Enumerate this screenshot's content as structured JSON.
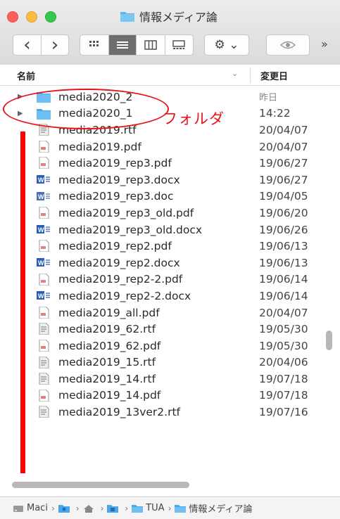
{
  "window": {
    "title": "情報メディア論"
  },
  "toolbar": {
    "back_label": "‹",
    "forward_label": "›",
    "gear_label": "⚙ ⌄",
    "eye_label": "◉",
    "overflow_label": "»"
  },
  "columns": {
    "name": "名前",
    "date": "変更日"
  },
  "files": [
    {
      "name": "media2020_2",
      "date": "昨日",
      "kind": "folder"
    },
    {
      "name": "media2020_1",
      "date": "14:22",
      "kind": "folder"
    },
    {
      "name": "media2019.rtf",
      "date": "20/04/07",
      "kind": "rtf"
    },
    {
      "name": "media2019.pdf",
      "date": "20/04/07",
      "kind": "pdf"
    },
    {
      "name": "media2019_rep3.pdf",
      "date": "19/06/27",
      "kind": "pdf"
    },
    {
      "name": "media2019_rep3.docx",
      "date": "19/06/27",
      "kind": "docx"
    },
    {
      "name": "media2019_rep3.doc",
      "date": "19/04/05",
      "kind": "doc"
    },
    {
      "name": "media2019_rep3_old.pdf",
      "date": "19/06/20",
      "kind": "pdf"
    },
    {
      "name": "media2019_rep3_old.docx",
      "date": "19/06/26",
      "kind": "docx"
    },
    {
      "name": "media2019_rep2.pdf",
      "date": "19/06/13",
      "kind": "pdf"
    },
    {
      "name": "media2019_rep2.docx",
      "date": "19/06/13",
      "kind": "docx"
    },
    {
      "name": "media2019_rep2-2.pdf",
      "date": "19/06/14",
      "kind": "pdf"
    },
    {
      "name": "media2019_rep2-2.docx",
      "date": "19/06/14",
      "kind": "docx"
    },
    {
      "name": "media2019_all.pdf",
      "date": "20/04/07",
      "kind": "pdf"
    },
    {
      "name": "media2019_62.rtf",
      "date": "19/05/30",
      "kind": "rtf"
    },
    {
      "name": "media2019_62.pdf",
      "date": "19/05/30",
      "kind": "pdf"
    },
    {
      "name": "media2019_15.rtf",
      "date": "20/04/06",
      "kind": "rtf"
    },
    {
      "name": "media2019_14.rtf",
      "date": "19/07/18",
      "kind": "rtf"
    },
    {
      "name": "media2019_14.pdf",
      "date": "19/07/18",
      "kind": "pdf"
    },
    {
      "name": "media2019_13ver2.rtf",
      "date": "19/07/16",
      "kind": "rtf"
    }
  ],
  "annotation": {
    "label": "フォルダ",
    "color": "#e8131a"
  },
  "pathbar": {
    "crumbs": [
      {
        "label": "Maci",
        "icon": "disk-icon"
      },
      {
        "label": "",
        "icon": "user-folder-icon"
      },
      {
        "label": "",
        "icon": "home-icon"
      },
      {
        "label": "",
        "icon": "documents-folder-icon"
      },
      {
        "label": "TUA",
        "icon": "folder-icon"
      },
      {
        "label": "情報メディア論",
        "icon": "folder-icon"
      }
    ]
  },
  "colors": {
    "folder": "#5ab4f0",
    "word": "#2b5eb8",
    "close": "#fc605c",
    "minimize": "#fdbc40",
    "maximize": "#34c84a"
  }
}
